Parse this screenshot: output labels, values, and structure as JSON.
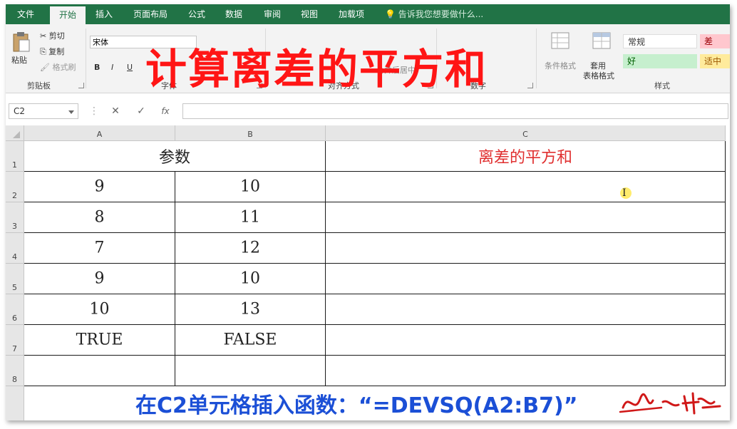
{
  "ribbon": {
    "tabs": [
      "文件",
      "开始",
      "插入",
      "页面布局",
      "公式",
      "数据",
      "审阅",
      "视图",
      "加载项"
    ],
    "active_tab": "开始",
    "tell_me": "告诉我您想要做什么...",
    "clipboard": {
      "paste": "粘贴",
      "cut": "剪切",
      "copy": "复制",
      "format_painter": "格式刷",
      "label": "剪贴板"
    },
    "font": {
      "name": "宋体",
      "bold": "B",
      "italic": "I",
      "underline": "U",
      "label": "字体"
    },
    "alignment": {
      "label": "对齐方式",
      "merge": "合并后居中"
    },
    "number": {
      "label": "数字"
    },
    "styles": {
      "conditional": "条件格式",
      "table_format_1": "套用",
      "table_format_2": "表格格式",
      "normal": "常规",
      "bad": "差",
      "good": "好",
      "neutral": "适中",
      "label": "样式"
    }
  },
  "overlay_title": "计算离差的平方和",
  "formula_bar": {
    "name_box": "C2",
    "cancel": "✕",
    "enter": "✓",
    "fx": "fx",
    "formula": ""
  },
  "sheet": {
    "columns": [
      "A",
      "B",
      "C"
    ],
    "rows": [
      "1",
      "2",
      "3",
      "4",
      "5",
      "6",
      "7",
      "8"
    ],
    "header_merged": "参数",
    "header_c": "离差的平方和",
    "data": [
      [
        "9",
        "10"
      ],
      [
        "8",
        "11"
      ],
      [
        "7",
        "12"
      ],
      [
        "9",
        "10"
      ],
      [
        "10",
        "13"
      ],
      [
        "TRUE",
        "FALSE"
      ],
      [
        "",
        ""
      ]
    ]
  },
  "caption": "在C2单元格插入函数：“=DEVSQ(A2:B7)”",
  "colors": {
    "excel_green": "#217346",
    "title_red": "#ff1515",
    "caption_blue": "#1b4fd6",
    "header_c_red": "#e03030"
  }
}
